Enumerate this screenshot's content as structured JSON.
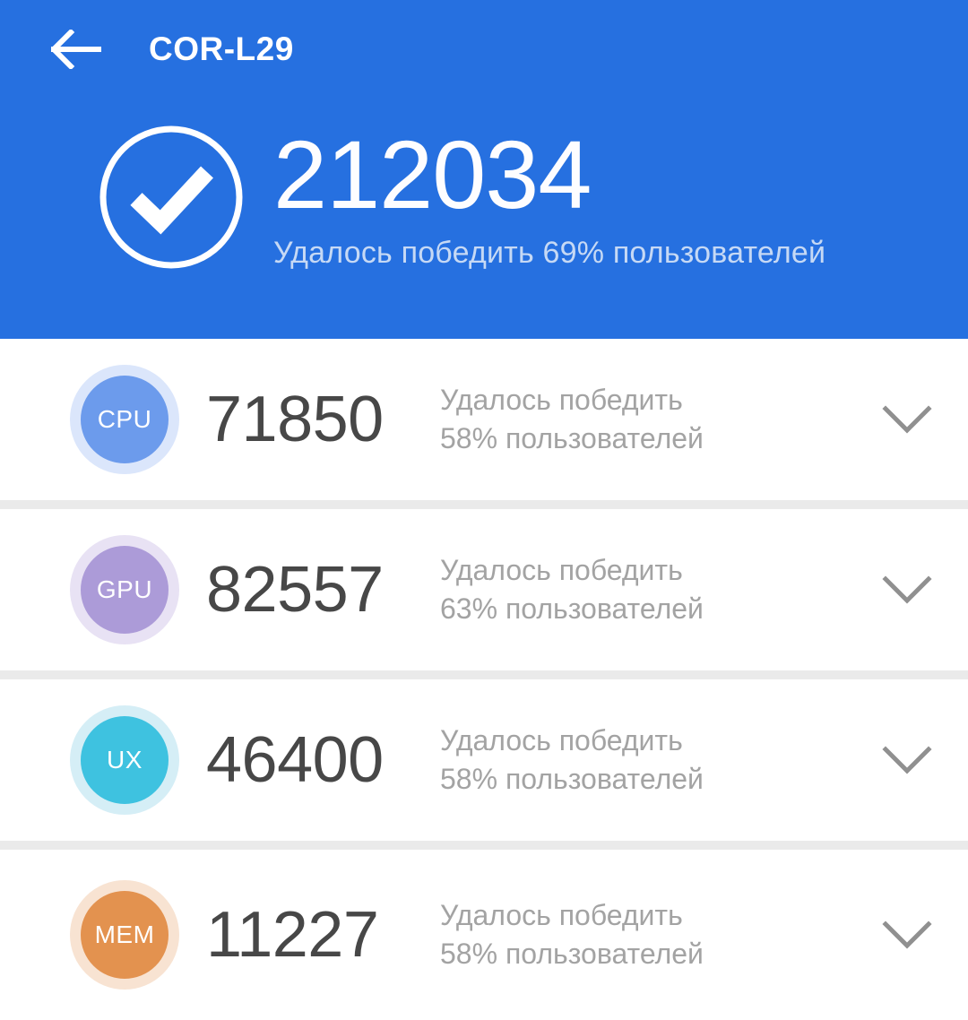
{
  "appbar": {
    "back_icon": "back-arrow-icon",
    "title": "COR-L29"
  },
  "summary": {
    "status_icon": "check-circle-icon",
    "total_score": "212034",
    "subtitle": "Удалось победить 69% пользователей",
    "percent": "69%",
    "background_color": "#2670e0",
    "subtitle_color": "#c6d9f5"
  },
  "metrics": [
    {
      "key": "cpu",
      "label": "CPU",
      "score": "71850",
      "desc_line1": "Удалось победить",
      "desc_line2": "58% пользователей",
      "percent": "58%",
      "color": "#6c9bec",
      "halo": "#dbe6fb",
      "expand_icon": "chevron-down-icon"
    },
    {
      "key": "gpu",
      "label": "GPU",
      "score": "82557",
      "desc_line1": "Удалось победить",
      "desc_line2": "63% пользователей",
      "percent": "63%",
      "color": "#ac9bd8",
      "halo": "#e8e2f4",
      "expand_icon": "chevron-down-icon"
    },
    {
      "key": "ux",
      "label": "UX",
      "score": "46400",
      "desc_line1": "Удалось победить",
      "desc_line2": "58% пользователей",
      "percent": "58%",
      "color": "#3ec2e0",
      "halo": "#d5eef6",
      "expand_icon": "chevron-down-icon"
    },
    {
      "key": "mem",
      "label": "MEM",
      "score": "11227",
      "desc_line1": "Удалось победить",
      "desc_line2": "58% пользователей",
      "percent": "58%",
      "color": "#e3924f",
      "halo": "#f8e3d2",
      "expand_icon": "chevron-down-icon"
    }
  ]
}
